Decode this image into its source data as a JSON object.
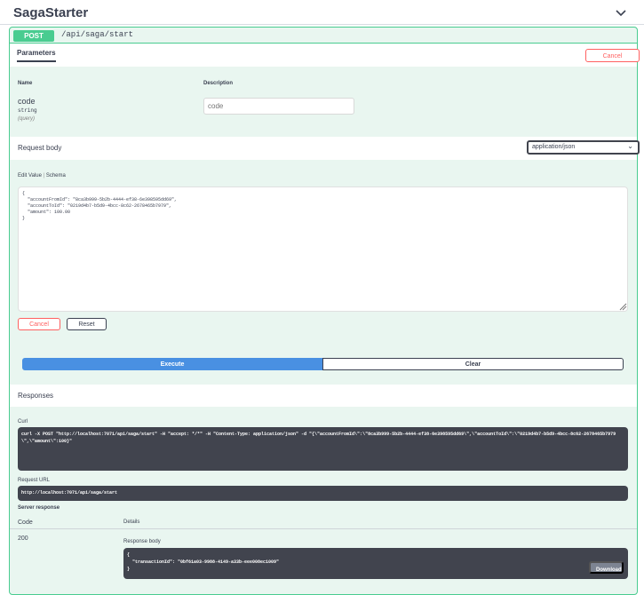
{
  "tag": {
    "title": "SagaStarter"
  },
  "operation": {
    "method": "POST",
    "path": "/api/saga/start"
  },
  "parameters": {
    "tab_label": "Parameters",
    "cancel_label": "Cancel",
    "col_name": "Name",
    "col_description": "Description",
    "items": [
      {
        "name": "code",
        "type": "string",
        "in": "(query)",
        "placeholder": "code"
      }
    ]
  },
  "request_body": {
    "label": "Request body",
    "content_type": "application/json",
    "tab_edit": "Edit Value",
    "tab_schema": "Schema",
    "json": "{\n  \"accountFromId\": \"8ca3b999-5b2b-4444-ef38-6e398595dd69\",\n  \"accountToId\": \"0219d4b7-b5d9-4bcc-8c62-2678465b7979\",\n  \"amount\": 100.00\n}"
  },
  "actions": {
    "cancel_label": "Cancel",
    "reset_label": "Reset",
    "execute_label": "Execute",
    "clear_label": "Clear"
  },
  "responses": {
    "title": "Responses",
    "curl_label": "Curl",
    "curl": "curl -X POST \"http://localhost:7071/api/saga/start\" -H \"accept: */*\" -H \"Content-Type: application/json\" -d \"{\\\"accountFromId\\\":\\\"8ca3b999-5b2b-4444-ef38-6e398595dd69\\\",\\\"accountToId\\\":\\\"0219d4b7-b5d9-4bcc-8c62-2678465b7979\\\",\\\"amount\\\":100}\"",
    "request_url_label": "Request URL",
    "request_url": "http://localhost:7071/api/saga/start",
    "server_response_label": "Server response",
    "col_code": "Code",
    "col_details": "Details",
    "status_code": "200",
    "response_body_label": "Response body",
    "response_body": "{\n  \"transactionId\": \"0bf61a03-9988-4149-a33b-eee008ec1009\"\n}",
    "download_label": "Download"
  },
  "colors": {
    "post_green": "#49cc90",
    "execute_blue": "#4990e2",
    "cancel_red": "#ff6060",
    "dark_code_bg": "#41444e"
  }
}
